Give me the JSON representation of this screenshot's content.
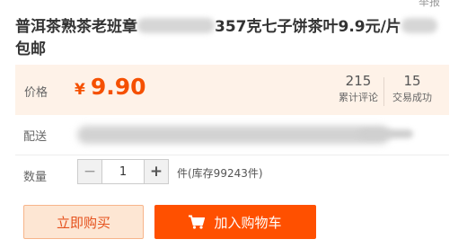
{
  "header": {
    "report_label": "举报"
  },
  "product": {
    "title_part1": "普洱茶熟茶老班章",
    "title_part2": "357克七子饼茶叶9.9元/片",
    "title_part3": "包邮"
  },
  "price": {
    "label": "价格",
    "currency_symbol": "¥",
    "value": "9.90"
  },
  "stats": {
    "reviews_count": "215",
    "reviews_label": "累计评论",
    "trades_count": "15",
    "trades_label": "交易成功"
  },
  "shipping": {
    "label": "配送"
  },
  "quantity": {
    "label": "数量",
    "value": "1",
    "minus": "−",
    "plus": "+",
    "stock_text": "件(库存99243件)"
  },
  "actions": {
    "buy_now_label": "立即购买",
    "add_to_cart_label": "加入购物车"
  },
  "colors": {
    "accent": "#ff5000",
    "price": "#f55000",
    "price_bg": "#fef2e8"
  }
}
